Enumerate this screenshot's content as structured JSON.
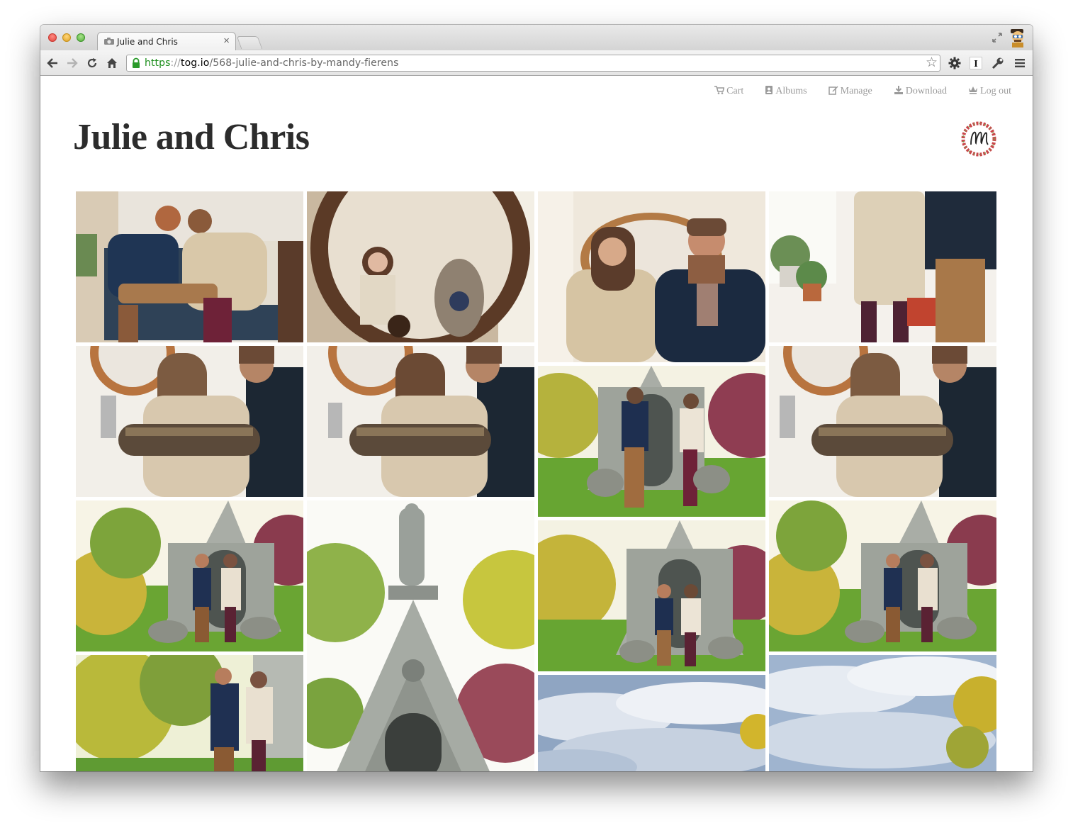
{
  "browser": {
    "tab_title": "Julie and Chris",
    "url": {
      "scheme": "https",
      "separator": "://",
      "host": "tog.io",
      "path": "/568-julie-and-chris-by-mandy-fierens"
    }
  },
  "nav": {
    "cart": "Cart",
    "albums": "Albums",
    "manage": "Manage",
    "download": "Download",
    "logout": "Log out"
  },
  "gallery": {
    "title": "Julie and Chris"
  },
  "photos": [
    {
      "scene": "couple-on-couch"
    },
    {
      "scene": "mirror-reflection"
    },
    {
      "scene": "couple-in-front-of-mirror"
    },
    {
      "scene": "holding-hands-detail"
    },
    {
      "scene": "couple-with-cat"
    },
    {
      "scene": "couple-with-cat-smiling"
    },
    {
      "scene": "walking-to-mausoleum"
    },
    {
      "scene": "couple-with-cat-close"
    },
    {
      "scene": "couple-at-mausoleum"
    },
    {
      "scene": "mausoleum-statue"
    },
    {
      "scene": "couple-at-mausoleum-wide"
    },
    {
      "scene": "couple-at-mausoleum-walking"
    },
    {
      "scene": "couple-walking-trees"
    },
    {
      "scene": "cloudy-sky"
    },
    {
      "scene": "cloudy-sky-tree"
    }
  ],
  "colors": {
    "nav_text": "#9a9a9a",
    "title_text": "#2c2c2c",
    "url_scheme": "#1c8e1c"
  }
}
